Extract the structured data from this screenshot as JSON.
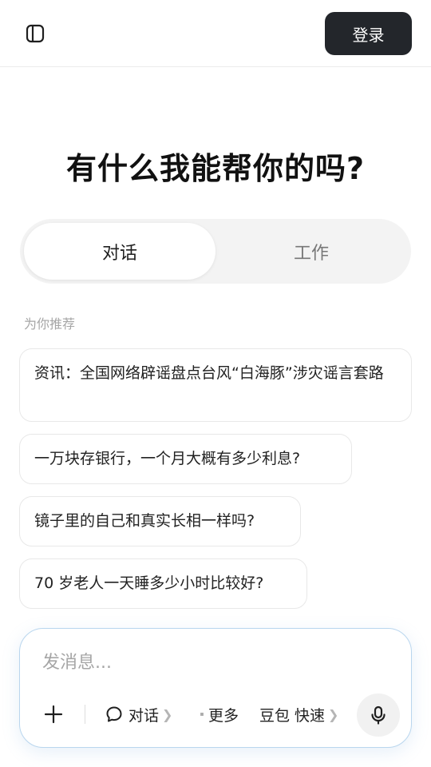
{
  "header": {
    "login_label": "登录",
    "sidebar_icon": "sidebar-toggle-icon"
  },
  "main": {
    "title": "有什么我能帮你的吗?",
    "mode_tabs": [
      {
        "label": "对话",
        "active": true
      },
      {
        "label": "工作",
        "active": false
      }
    ],
    "recommend_label": "为你推荐",
    "suggestions": [
      "资讯：全国网络辟谣盘点台风“白海豚”涉灾谣言套路",
      "一万块存银行，一个月大概有多少利息?",
      "镜子里的自己和真实长相一样吗?",
      "70 岁老人一天睡多少小时比较好?"
    ]
  },
  "composer": {
    "placeholder": "发消息...",
    "chat_label": "对话",
    "more_label": "更多",
    "model_name": "豆包",
    "model_mode": "快速",
    "chevron": "❯",
    "icons": [
      "plus-icon",
      "chat-bubble-icon",
      "grid-icon",
      "microphone-icon"
    ]
  },
  "colors": {
    "login_bg": "#23262b",
    "composer_border": "#b9d6ee",
    "switch_bg": "#f3f3f3"
  }
}
